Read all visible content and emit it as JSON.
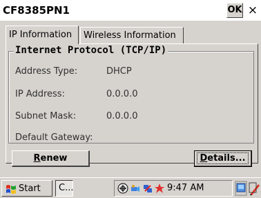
{
  "window": {
    "title": "CF8385PN1",
    "ok_label": "OK",
    "close_label": "×"
  },
  "tabs": [
    {
      "label": "IP Information",
      "active": true
    },
    {
      "label": "Wireless Information",
      "active": false
    }
  ],
  "group": {
    "title": "Internet Protocol (TCP/IP)",
    "fields": [
      {
        "label": "Address Type:",
        "value": "DHCP"
      },
      {
        "label": "IP Address:",
        "value": "0.0.0.0"
      },
      {
        "label": "Subnet Mask:",
        "value": "0.0.0.0"
      },
      {
        "label": "Default Gateway:",
        "value": ""
      }
    ]
  },
  "buttons": {
    "renew_underlined": "R",
    "renew_rest": "enew",
    "details_underlined": "D",
    "details_rest": "etails..."
  },
  "taskbar": {
    "start_label": "Start",
    "task_label": "C...",
    "clock": "9:47 AM",
    "tray_icons": [
      "network-icon",
      "bluetooth-icon",
      "connection-icon",
      "sync-icon"
    ],
    "colors": {
      "window_bg": "#d6d3ce",
      "titlebar_bg": "#ffffff"
    }
  }
}
